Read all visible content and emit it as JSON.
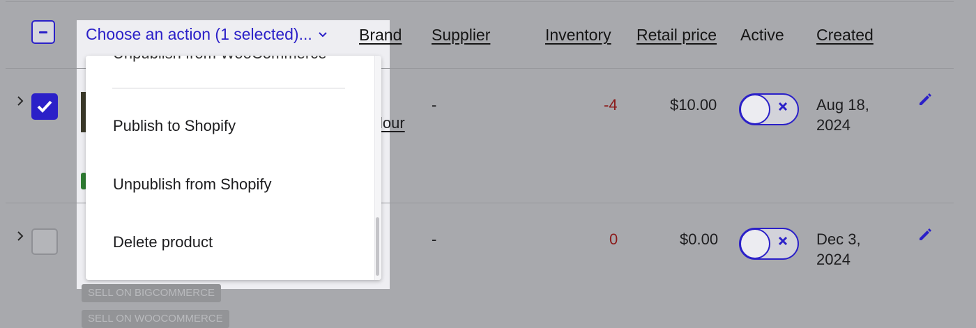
{
  "header": {
    "action_label": "Choose an action (1 selected)...",
    "columns": {
      "brand": "Brand",
      "supplier": "Supplier",
      "inventory": "Inventory",
      "retail_price": "Retail price",
      "active": "Active",
      "created": "Created"
    }
  },
  "action_menu": {
    "cut_item": "Unpublish from WooCommerce",
    "items": [
      "Publish to Shopify",
      "Unpublish from Shopify",
      "Delete product"
    ]
  },
  "rows": [
    {
      "checked": true,
      "brand_fragment": "lour",
      "supplier": "-",
      "inventory": "-4",
      "retail_price": "$10.00",
      "active": false,
      "created_line1": "Aug 18,",
      "created_line2": "2024"
    },
    {
      "checked": false,
      "supplier": "-",
      "inventory": "0",
      "retail_price": "$0.00",
      "active": false,
      "created_line1": "Dec 3,",
      "created_line2": "2024",
      "badges": [
        "SELL ON BIGCOMMERCE",
        "SELL ON WOOCOMMERCE"
      ]
    }
  ],
  "colors": {
    "accent": "#2b20c8",
    "negative": "#8b1a1a",
    "overlay_bg": "#a8a9ad"
  }
}
